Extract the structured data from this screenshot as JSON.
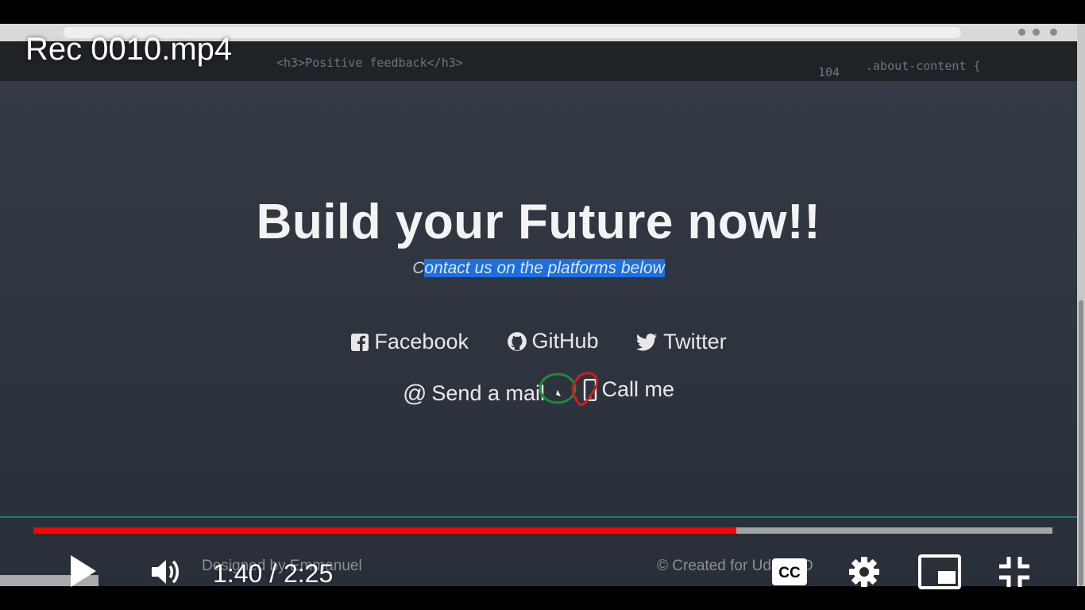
{
  "video": {
    "title": "Rec 0010.mp4",
    "current_time": "1:40",
    "duration": "2:25",
    "time_display": "1:40 / 2:25",
    "progress": 0.69,
    "accent_color": "#ff0000"
  },
  "page": {
    "code_left": "<h3>Positive feedback</h3>",
    "code_line_num": "104",
    "code_right": ".about-content {",
    "headline": "Build your Future now!!",
    "subline_prefix": "C",
    "subline_selected": "ontact us on the platforms below",
    "links_row1": [
      {
        "label": "Facebook",
        "icon": "facebook-icon"
      },
      {
        "label": "GitHub",
        "icon": "github-icon"
      },
      {
        "label": "Twitter",
        "icon": "twitter-icon"
      }
    ],
    "links_row2": [
      {
        "label": "Send a mail",
        "icon": "at-icon"
      },
      {
        "label": "Call me",
        "icon": "phone-icon"
      }
    ],
    "footer_left": "Designed by Emmanuel",
    "footer_right": "© Created for UdacityD"
  },
  "controls": {
    "play_icon": "play-icon",
    "volume_icon": "volume-icon",
    "captions_icon": "closed-captions-icon",
    "settings_icon": "gear-icon",
    "miniplayer_icon": "miniplayer-icon",
    "exit_fullscreen_icon": "exit-fullscreen-icon"
  }
}
